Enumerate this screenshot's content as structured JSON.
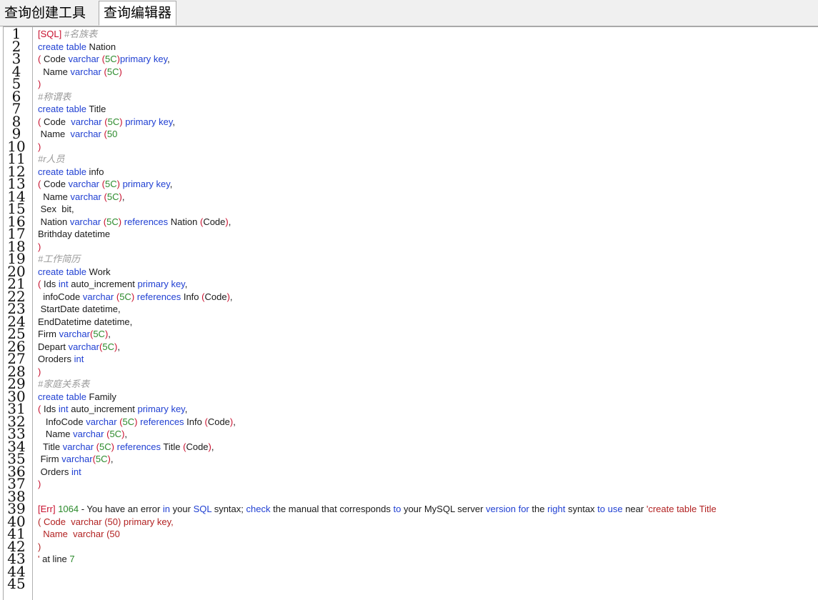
{
  "tabs": [
    {
      "label": "查询创建工具",
      "active": false
    },
    {
      "label": "查询编辑器",
      "active": true
    }
  ],
  "colors": {
    "keyword": "#1f3fd2",
    "paren": "#c8102e",
    "number": "#2c8a2c",
    "string": "#b22222",
    "comment": "#9a9a9a"
  },
  "editor": {
    "line_numbers": [
      "1",
      "2",
      "3",
      "4",
      "5",
      "6",
      "7",
      "8",
      "9",
      "10",
      "11",
      "12",
      "13",
      "14",
      "15",
      "16",
      "17",
      "18",
      "19",
      "20",
      "21",
      "22",
      "23",
      "24",
      "25",
      "26",
      "27",
      "28",
      "29",
      "30",
      "31",
      "32",
      "33",
      "34",
      "35",
      "36",
      "37",
      "38",
      "39",
      "40",
      "41",
      "42",
      "43",
      "44",
      "45"
    ],
    "lines": [
      [
        [
          "p",
          "[SQL]"
        ],
        [
          "cm",
          " #名族表"
        ]
      ],
      [
        [
          "kw",
          "create table"
        ],
        [
          "t",
          " Nation"
        ]
      ],
      [
        [
          "p",
          "("
        ],
        [
          "t",
          " Code "
        ],
        [
          "kw",
          "varchar"
        ],
        [
          "t",
          " "
        ],
        [
          "p",
          "("
        ],
        [
          "num",
          "5C"
        ],
        [
          "p",
          ")"
        ],
        [
          "kw",
          "primary key"
        ],
        [
          "t",
          ","
        ]
      ],
      [
        [
          "t",
          "  Name "
        ],
        [
          "kw",
          "varchar"
        ],
        [
          "t",
          " "
        ],
        [
          "p",
          "("
        ],
        [
          "num",
          "5C"
        ],
        [
          "p",
          ")"
        ]
      ],
      [
        [
          "p",
          ")"
        ]
      ],
      [
        [
          "cm",
          "#称谓表"
        ]
      ],
      [
        [
          "kw",
          "create table"
        ],
        [
          "t",
          " Title"
        ]
      ],
      [
        [
          "p",
          "("
        ],
        [
          "t",
          " Code  "
        ],
        [
          "kw",
          "varchar"
        ],
        [
          "t",
          " "
        ],
        [
          "p",
          "("
        ],
        [
          "num",
          "5C"
        ],
        [
          "p",
          ")"
        ],
        [
          "t",
          " "
        ],
        [
          "kw",
          "primary key"
        ],
        [
          "t",
          ","
        ]
      ],
      [
        [
          "t",
          " Name  "
        ],
        [
          "kw",
          "varchar"
        ],
        [
          "t",
          " "
        ],
        [
          "p",
          "("
        ],
        [
          "num",
          "50"
        ]
      ],
      [
        [
          "p",
          ")"
        ]
      ],
      [
        [
          "cm",
          "#r人员"
        ]
      ],
      [
        [
          "kw",
          "create table"
        ],
        [
          "t",
          " info"
        ]
      ],
      [
        [
          "p",
          "("
        ],
        [
          "t",
          " Code "
        ],
        [
          "kw",
          "varchar"
        ],
        [
          "t",
          " "
        ],
        [
          "p",
          "("
        ],
        [
          "num",
          "5C"
        ],
        [
          "p",
          ")"
        ],
        [
          "t",
          " "
        ],
        [
          "kw",
          "primary key"
        ],
        [
          "t",
          ","
        ]
      ],
      [
        [
          "t",
          "  Name "
        ],
        [
          "kw",
          "varchar"
        ],
        [
          "t",
          " "
        ],
        [
          "p",
          "("
        ],
        [
          "num",
          "5C"
        ],
        [
          "p",
          ")"
        ],
        [
          "t",
          ","
        ]
      ],
      [
        [
          "t",
          " Sex  bit,"
        ]
      ],
      [
        [
          "t",
          " Nation "
        ],
        [
          "kw",
          "varchar"
        ],
        [
          "t",
          " "
        ],
        [
          "p",
          "("
        ],
        [
          "num",
          "5C"
        ],
        [
          "p",
          ")"
        ],
        [
          "t",
          " "
        ],
        [
          "kw",
          "references"
        ],
        [
          "t",
          " Nation "
        ],
        [
          "p",
          "("
        ],
        [
          "t",
          "Code"
        ],
        [
          "p",
          ")"
        ],
        [
          "t",
          ","
        ]
      ],
      [
        [
          "t",
          "Brithday datetime"
        ]
      ],
      [
        [
          "p",
          ")"
        ]
      ],
      [
        [
          "cm",
          "#工作简历"
        ]
      ],
      [
        [
          "kw",
          "create table"
        ],
        [
          "t",
          " Work"
        ]
      ],
      [
        [
          "p",
          "("
        ],
        [
          "t",
          " Ids "
        ],
        [
          "kw",
          "int"
        ],
        [
          "t",
          " auto_increment "
        ],
        [
          "kw",
          "primary key"
        ],
        [
          "t",
          ","
        ]
      ],
      [
        [
          "t",
          "  infoCode "
        ],
        [
          "kw",
          "varchar"
        ],
        [
          "t",
          " "
        ],
        [
          "p",
          "("
        ],
        [
          "num",
          "5C"
        ],
        [
          "p",
          ")"
        ],
        [
          "t",
          " "
        ],
        [
          "kw",
          "references"
        ],
        [
          "t",
          " Info "
        ],
        [
          "p",
          "("
        ],
        [
          "t",
          "Code"
        ],
        [
          "p",
          ")"
        ],
        [
          "t",
          ","
        ]
      ],
      [
        [
          "t",
          " StartDate datetime,"
        ]
      ],
      [
        [
          "t",
          "EndDatetime datetime,"
        ]
      ],
      [
        [
          "t",
          "Firm "
        ],
        [
          "kw",
          "varchar"
        ],
        [
          "p",
          "("
        ],
        [
          "num",
          "5C"
        ],
        [
          "p",
          ")"
        ],
        [
          "t",
          ","
        ]
      ],
      [
        [
          "t",
          "Depart "
        ],
        [
          "kw",
          "varchar"
        ],
        [
          "p",
          "("
        ],
        [
          "num",
          "5C"
        ],
        [
          "p",
          ")"
        ],
        [
          "t",
          ","
        ]
      ],
      [
        [
          "t",
          "Oroders "
        ],
        [
          "kw",
          "int"
        ]
      ],
      [
        [
          "p",
          ")"
        ]
      ],
      [
        [
          "cm",
          "#家庭关系表"
        ]
      ],
      [
        [
          "kw",
          "create table"
        ],
        [
          "t",
          " Family"
        ]
      ],
      [
        [
          "p",
          "("
        ],
        [
          "t",
          " Ids "
        ],
        [
          "kw",
          "int"
        ],
        [
          "t",
          " auto_increment "
        ],
        [
          "kw",
          "primary key"
        ],
        [
          "t",
          ","
        ]
      ],
      [
        [
          "t",
          "   InfoCode "
        ],
        [
          "kw",
          "varchar"
        ],
        [
          "t",
          " "
        ],
        [
          "p",
          "("
        ],
        [
          "num",
          "5C"
        ],
        [
          "p",
          ")"
        ],
        [
          "t",
          " "
        ],
        [
          "kw",
          "references"
        ],
        [
          "t",
          " Info "
        ],
        [
          "p",
          "("
        ],
        [
          "t",
          "Code"
        ],
        [
          "p",
          ")"
        ],
        [
          "t",
          ","
        ]
      ],
      [
        [
          "t",
          "   Name "
        ],
        [
          "kw",
          "varchar"
        ],
        [
          "t",
          " "
        ],
        [
          "p",
          "("
        ],
        [
          "num",
          "5C"
        ],
        [
          "p",
          ")"
        ],
        [
          "t",
          ","
        ]
      ],
      [
        [
          "t",
          "  Title "
        ],
        [
          "kw",
          "varchar"
        ],
        [
          "t",
          " "
        ],
        [
          "p",
          "("
        ],
        [
          "num",
          "5C"
        ],
        [
          "p",
          ")"
        ],
        [
          "t",
          " "
        ],
        [
          "kw",
          "references"
        ],
        [
          "t",
          " Title "
        ],
        [
          "p",
          "("
        ],
        [
          "t",
          "Code"
        ],
        [
          "p",
          ")"
        ],
        [
          "t",
          ","
        ]
      ],
      [
        [
          "t",
          " Firm "
        ],
        [
          "kw",
          "varchar"
        ],
        [
          "p",
          "("
        ],
        [
          "num",
          "5C"
        ],
        [
          "p",
          ")"
        ],
        [
          "t",
          ","
        ]
      ],
      [
        [
          "t",
          " Orders "
        ],
        [
          "kw",
          "int"
        ]
      ],
      [
        [
          "p",
          ")"
        ]
      ],
      [],
      [
        [
          "p",
          "[Err]"
        ],
        [
          "t",
          " "
        ],
        [
          "num",
          "1064"
        ],
        [
          "t",
          " - You have an error "
        ],
        [
          "kw",
          "in"
        ],
        [
          "t",
          " your "
        ],
        [
          "kw",
          "SQL"
        ],
        [
          "t",
          " syntax; "
        ],
        [
          "kw",
          "check"
        ],
        [
          "t",
          " the manual that corresponds "
        ],
        [
          "kw",
          "to"
        ],
        [
          "t",
          " your MySQL server "
        ],
        [
          "kw",
          "version"
        ],
        [
          "t",
          " "
        ],
        [
          "kw",
          "for"
        ],
        [
          "t",
          " the "
        ],
        [
          "kw",
          "right"
        ],
        [
          "t",
          " syntax "
        ],
        [
          "kw",
          "to"
        ],
        [
          "t",
          " "
        ],
        [
          "kw",
          "use"
        ],
        [
          "t",
          " near "
        ],
        [
          "str",
          "'create table Title"
        ]
      ],
      [
        [
          "str",
          "( Code  varchar (50) primary key,"
        ]
      ],
      [
        [
          "str",
          "  Name  varchar (50"
        ]
      ],
      [
        [
          "str",
          ")"
        ]
      ],
      [
        [
          "str",
          "'"
        ],
        [
          "t",
          " at line "
        ],
        [
          "num",
          "7"
        ]
      ],
      [],
      []
    ]
  }
}
